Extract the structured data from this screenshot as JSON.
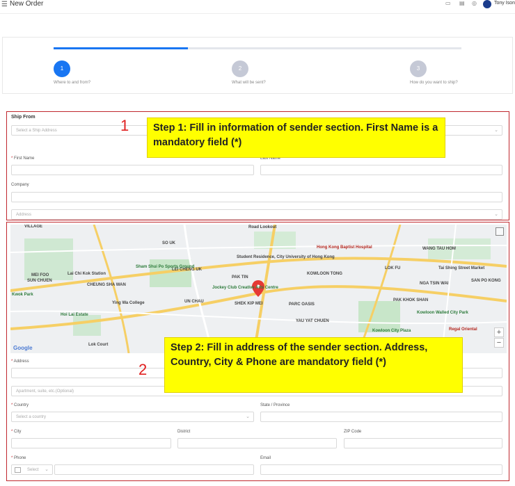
{
  "header": {
    "title": "New Order",
    "user": "Tony Ison"
  },
  "stepper": {
    "progress": 0.33,
    "steps": [
      {
        "num": "1",
        "label": "Where to and from?",
        "active": true
      },
      {
        "num": "2",
        "label": "What will be sent?",
        "active": false
      },
      {
        "num": "3",
        "label": "How do you want to ship?",
        "active": false
      }
    ]
  },
  "ship_from": {
    "heading": "Ship From",
    "select_placeholder": "Select a Ship Address",
    "first_name_label": "First Name",
    "last_name_label": "Last Name",
    "company_label": "Company",
    "address_placeholder": "Address"
  },
  "address_form": {
    "address_label": "Address",
    "apartment_placeholder": "Apartment, suite, etc.(Optional)",
    "country_label": "Country",
    "country_placeholder": "Select a country",
    "state_label": "State / Province",
    "city_label": "City",
    "district_label": "District",
    "zip_label": "ZIP Code",
    "phone_label": "Phone",
    "phone_code_placeholder": "Select",
    "email_label": "Email"
  },
  "map": {
    "attribution": "Google",
    "labels": [
      "SO UK",
      "LEI CHENG UK",
      "CHEUNG SHA WAN",
      "MEI FOO",
      "SUN CHUEN",
      "PAK TIN",
      "SHEK KIP MEI",
      "UN CHAU",
      "KOWLOON TONG",
      "PARC OASIS",
      "YAU YAT CHUEN",
      "PAK KHOK SHAN",
      "NGA TSIN WAI",
      "SAN PO KONG",
      "WANG TAU HOM",
      "LOK FU",
      "Hong Kong Baptist Hospital",
      "Sham Shui Po Sports Ground",
      "Jockey Club Creative Arts Centre",
      "Student Residence, City University of Hong Kong",
      "Road Lookout",
      "Regal Oriental",
      "Lai Chi Kok Station",
      "Kowloon Walled City Park",
      "Kowloon City Plaza",
      "Ying Wa College",
      "Hoi Lai Estate",
      "Tai Shing Street Market",
      "Lok Court",
      "Kwok Park"
    ]
  },
  "annotations": {
    "step1_number": "1",
    "step1_text": "Step 1: Fill in information of sender section. First Name is a mandatory field (*)",
    "step2_number": "2",
    "step2_text": "Step 2: Fill in address of the sender section. Address, Country, City & Phone are mandatory field (*)"
  },
  "colors": {
    "accent": "#1976f2",
    "annotation_border": "#c0272d",
    "callout": "#ffff00"
  }
}
